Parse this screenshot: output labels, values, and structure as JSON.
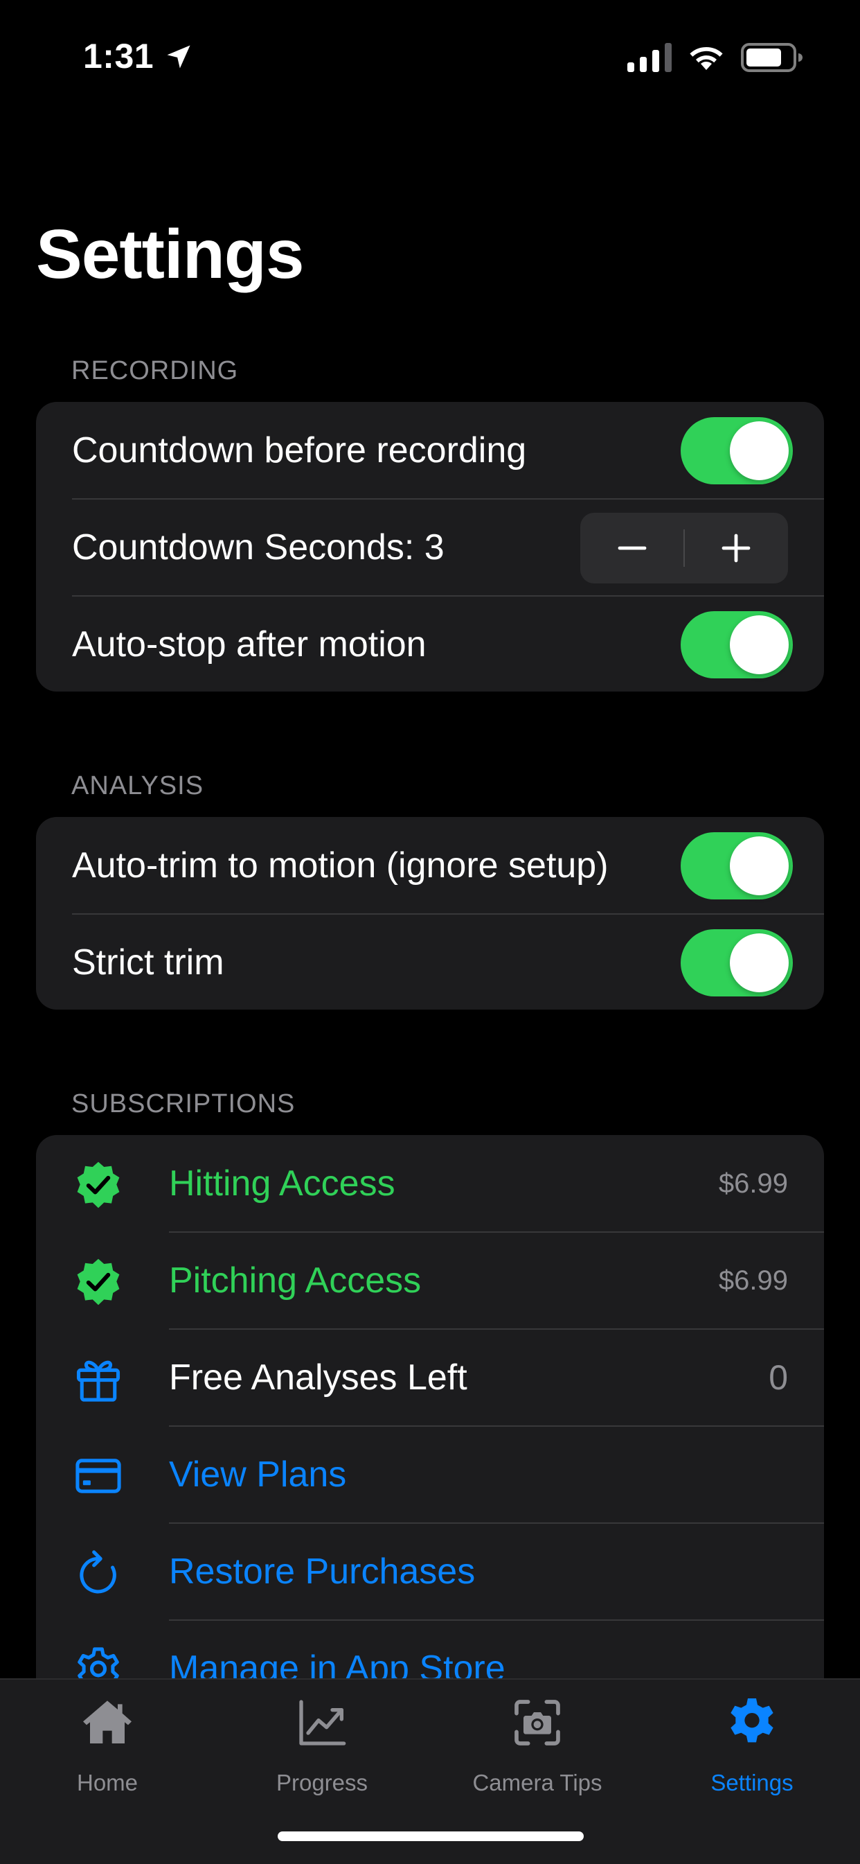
{
  "status_bar": {
    "time": "1:31"
  },
  "page_title": "Settings",
  "recording": {
    "header": "RECORDING",
    "countdown_label": "Countdown before recording",
    "countdown_enabled": true,
    "countdown_seconds_label": "Countdown Seconds: 3",
    "autostop_label": "Auto-stop after motion",
    "autostop_enabled": true
  },
  "analysis": {
    "header": "ANALYSIS",
    "autotrim_label": "Auto-trim to motion (ignore setup)",
    "autotrim_enabled": true,
    "strict_label": "Strict trim",
    "strict_enabled": true
  },
  "subscriptions": {
    "header": "SUBSCRIPTIONS",
    "items": [
      {
        "label": "Hitting Access",
        "value": "$6.99",
        "icon": "checkmark-seal-icon"
      },
      {
        "label": "Pitching Access",
        "value": "$6.99",
        "icon": "checkmark-seal-icon"
      },
      {
        "label": "Free Analyses Left",
        "value": "0",
        "icon": "gift-icon"
      },
      {
        "label": "View Plans",
        "value": "",
        "icon": "credit-card-icon"
      },
      {
        "label": "Restore Purchases",
        "value": "",
        "icon": "restore-icon"
      },
      {
        "label": "Manage in App Store",
        "value": "",
        "icon": "gear-icon"
      }
    ]
  },
  "tabs": [
    {
      "label": "Home",
      "icon": "home-icon"
    },
    {
      "label": "Progress",
      "icon": "chart-icon"
    },
    {
      "label": "Camera Tips",
      "icon": "camera-icon"
    },
    {
      "label": "Settings",
      "icon": "gear-icon"
    }
  ],
  "colors": {
    "accent_green": "#30d158",
    "accent_blue": "#0a84ff",
    "group_bg": "#1c1c1e",
    "secondary_text": "#8e8e93"
  }
}
